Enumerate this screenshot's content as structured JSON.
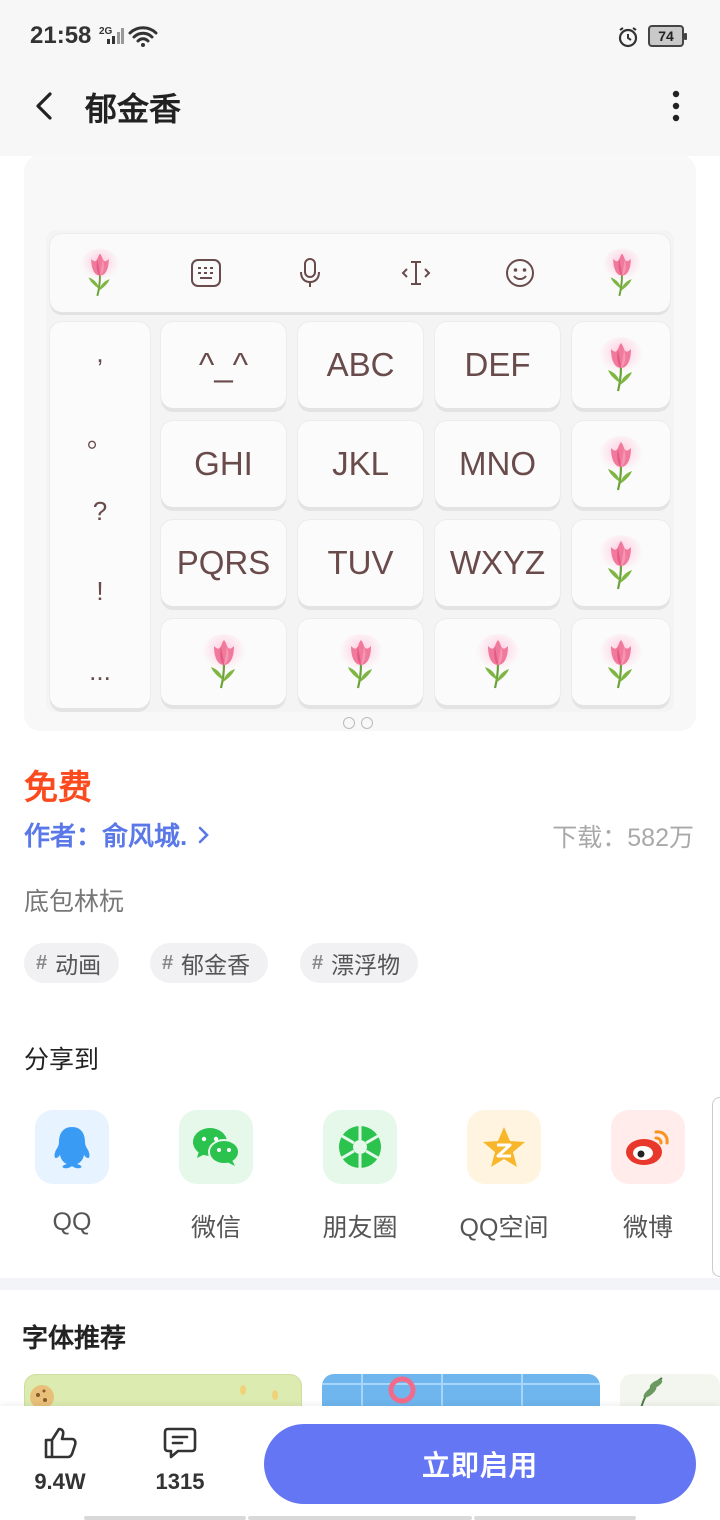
{
  "status_bar": {
    "time": "21:58",
    "network": "2G",
    "battery": "74"
  },
  "header": {
    "title": "郁金香"
  },
  "keyboard": {
    "row1": [
      "^_^",
      "ABC",
      "DEF"
    ],
    "row2": [
      "GHI",
      "JKL",
      "MNO"
    ],
    "row3": [
      "PQRS",
      "TUV",
      "WXYZ"
    ],
    "punctuation": [
      ",",
      "。",
      "?",
      "!",
      "..."
    ]
  },
  "product": {
    "price": "免费",
    "author": "作者：俞风城.",
    "downloads": "下载：582万",
    "description": "底包林杬",
    "tags": [
      "动画",
      "郁金香",
      "漂浮物"
    ],
    "tag_hash": "#"
  },
  "share": {
    "title": "分享到",
    "targets": [
      {
        "label": "QQ",
        "icon": "qq-icon",
        "bg": "#e7f3ff"
      },
      {
        "label": "微信",
        "icon": "wechat-icon",
        "bg": "#e6f8ea"
      },
      {
        "label": "朋友圈",
        "icon": "moments-icon",
        "bg": "#e6f8ea"
      },
      {
        "label": "QQ空间",
        "icon": "qzone-icon",
        "bg": "#fff4e0"
      },
      {
        "label": "微博",
        "icon": "weibo-icon",
        "bg": "#ffeceb"
      }
    ]
  },
  "recommend": {
    "title": "字体推荐"
  },
  "bottom_bar": {
    "likes": "9.4W",
    "comments": "1315",
    "enable_label": "立即启用"
  },
  "colors": {
    "accent": "#6476f4",
    "price": "#fa4a1e",
    "author": "#5a78e8"
  }
}
